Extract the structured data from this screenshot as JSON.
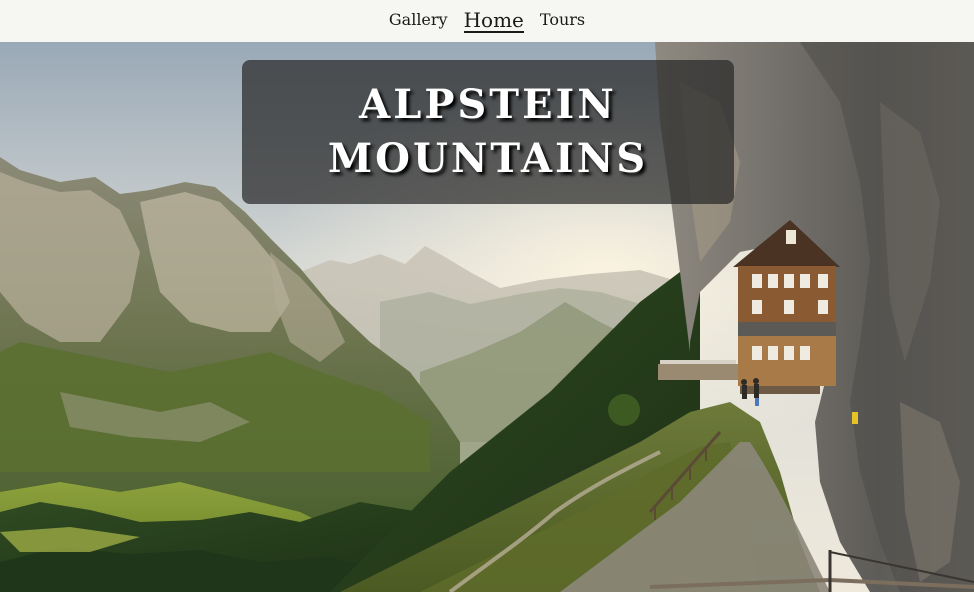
{
  "nav": {
    "items": [
      {
        "label": "Gallery",
        "active": false
      },
      {
        "label": "Home",
        "active": true
      },
      {
        "label": "Tours",
        "active": false
      }
    ]
  },
  "hero": {
    "title_line_1": "ALPSTEIN",
    "title_line_2": "MOUNTAINS"
  }
}
